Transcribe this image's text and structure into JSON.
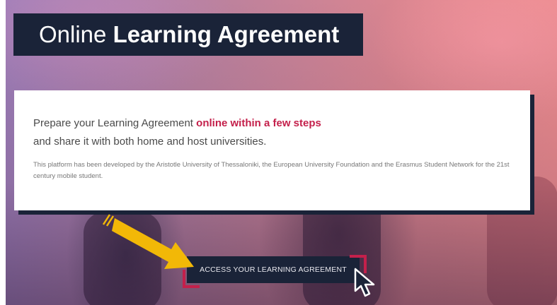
{
  "header": {
    "title_light": "Online",
    "title_bold": "Learning Agreement"
  },
  "intro": {
    "line1_prefix": "Prepare your Learning Agreement ",
    "line1_highlight": "online within a few steps",
    "line2": "and share it with both home and host universities.",
    "description": "This platform has been developed by the Aristotle University of Thessaloniki, the European University Foundation and the Erasmus Student Network for the 21st century mobile student."
  },
  "cta": {
    "label": "ACCESS YOUR LEARNING AGREEMENT"
  },
  "colors": {
    "navy": "#1a2338",
    "accent": "#c4204b",
    "annotation_arrow": "#f2b807"
  },
  "icons": {
    "annotation": "arrow-pointer-icon",
    "cursor": "mouse-cursor-icon"
  }
}
